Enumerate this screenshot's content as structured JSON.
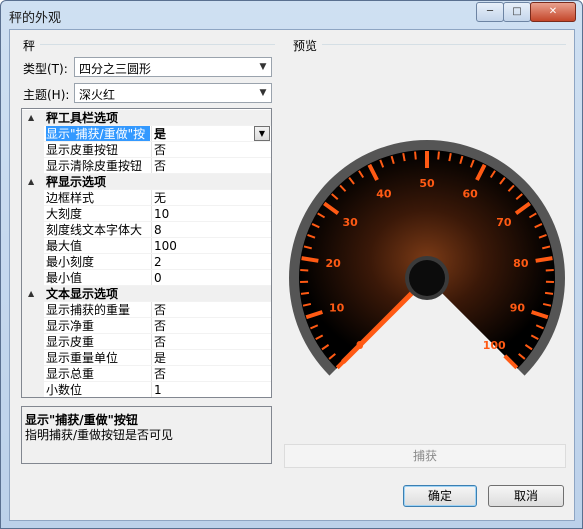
{
  "window": {
    "title": "秤的外观",
    "min": "─",
    "max": "□",
    "close": "✕"
  },
  "scale_group": {
    "label": "秤"
  },
  "type_field": {
    "label": "类型(T):",
    "value": "四分之三圆形"
  },
  "theme_field": {
    "label": "主题(H):",
    "value": "深火红"
  },
  "property_grid": {
    "categories": [
      {
        "name": "秤工具栏选项",
        "toggle": "▲",
        "rows": [
          {
            "name": "显示\"捕获/重做\"按",
            "value": "是",
            "selected": true
          },
          {
            "name": "显示皮重按钮",
            "value": "否"
          },
          {
            "name": "显示清除皮重按钮",
            "value": "否"
          }
        ]
      },
      {
        "name": "秤显示选项",
        "toggle": "▲",
        "rows": [
          {
            "name": "边框样式",
            "value": "无"
          },
          {
            "name": "大刻度",
            "value": "10"
          },
          {
            "name": "刻度线文本字体大",
            "value": "8"
          },
          {
            "name": "最大值",
            "value": "100"
          },
          {
            "name": "最小刻度",
            "value": "2"
          },
          {
            "name": "最小值",
            "value": "0"
          }
        ]
      },
      {
        "name": "文本显示选项",
        "toggle": "▲",
        "rows": [
          {
            "name": "显示捕获的重量",
            "value": "否"
          },
          {
            "name": "显示净重",
            "value": "否"
          },
          {
            "name": "显示皮重",
            "value": "否"
          },
          {
            "name": "显示重量单位",
            "value": "是"
          },
          {
            "name": "显示总重",
            "value": "否"
          },
          {
            "name": "小数位",
            "value": "1"
          }
        ]
      }
    ]
  },
  "help": {
    "title": "显示\"捕获/重做\"按钮",
    "text": "指明捕获/重做按钮是否可见"
  },
  "preview": {
    "label": "预览",
    "gauge": {
      "min": 0,
      "max": 100,
      "major_step": 10,
      "minor_per_major": 5,
      "tick_labels": [
        "0",
        "10",
        "20",
        "30",
        "40",
        "50",
        "60",
        "70",
        "80",
        "90",
        "100"
      ],
      "needle_value": 0,
      "colors": {
        "accent": "#ff5a14",
        "tick_minor": "#ff5a14",
        "face": "#000000",
        "bezel": "#555555"
      }
    }
  },
  "capture_button": {
    "label": "捕获"
  },
  "ok_button": {
    "label": "确定"
  },
  "cancel_button": {
    "label": "取消"
  }
}
